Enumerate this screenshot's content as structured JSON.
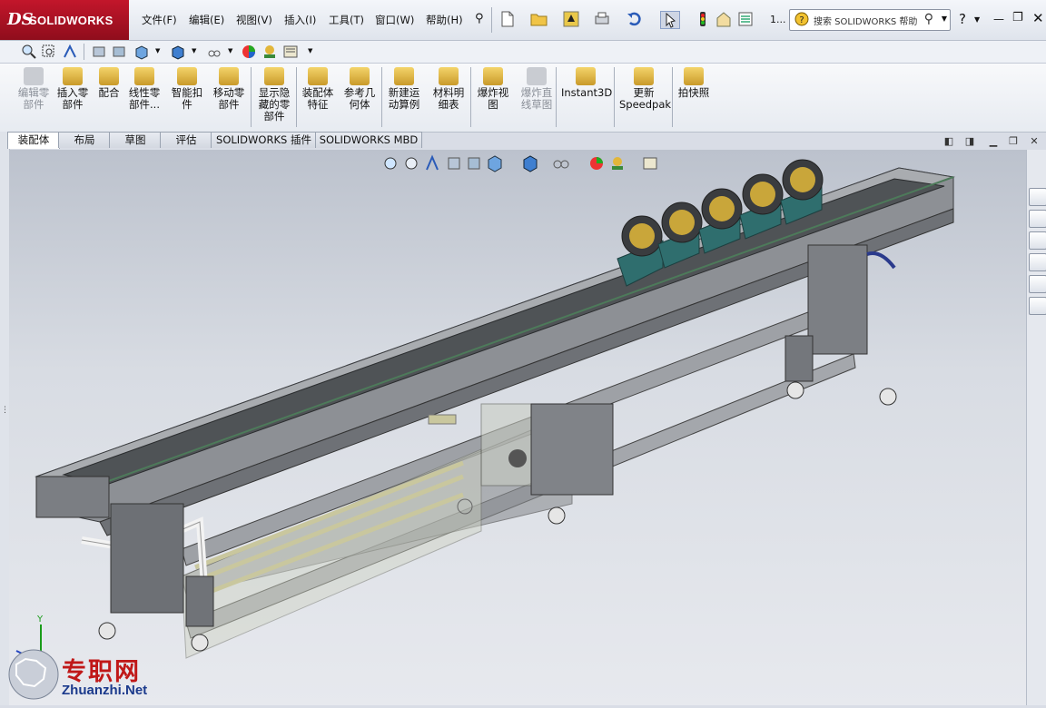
{
  "app": {
    "brand_ds": "DS",
    "brand_name": "SOLIDWORKS"
  },
  "menu": [
    "文件(F)",
    "编辑(E)",
    "视图(V)",
    "插入(I)",
    "工具(T)",
    "窗口(W)",
    "帮助(H)"
  ],
  "toolbar": {
    "counter": "1...",
    "search_placeholder": "搜索 SOLIDWORKS 帮助"
  },
  "command_manager": [
    {
      "label": "编辑零\n部件",
      "disabled": true,
      "icon": "edit-component-icon"
    },
    {
      "label": "插入零\n部件",
      "disabled": false,
      "icon": "insert-component-icon"
    },
    {
      "label": "配合",
      "disabled": false,
      "icon": "mate-icon"
    },
    {
      "label": "线性零\n部件...",
      "disabled": false,
      "icon": "linear-pattern-icon"
    },
    {
      "label": "智能扣\n件",
      "disabled": false,
      "icon": "smart-fastener-icon"
    },
    {
      "label": "移动零\n部件",
      "disabled": false,
      "icon": "move-component-icon"
    },
    {
      "label": "显示隐\n藏的零\n部件",
      "disabled": false,
      "icon": "show-hidden-icon"
    },
    {
      "label": "装配体\n特征",
      "disabled": false,
      "icon": "assembly-feature-icon"
    },
    {
      "label": "参考几\n何体",
      "disabled": false,
      "icon": "reference-geometry-icon"
    },
    {
      "label": "新建运\n动算例",
      "disabled": false,
      "icon": "motion-study-icon"
    },
    {
      "label": "材料明\n细表",
      "disabled": false,
      "icon": "bom-icon"
    },
    {
      "label": "爆炸视\n图",
      "disabled": false,
      "icon": "exploded-view-icon"
    },
    {
      "label": "爆炸直\n线草图",
      "disabled": true,
      "icon": "explode-line-icon"
    },
    {
      "label": "Instant3D",
      "disabled": false,
      "icon": "instant3d-icon"
    },
    {
      "label": "更新\nSpeedpak",
      "disabled": false,
      "icon": "speedpak-icon"
    },
    {
      "label": "拍快照",
      "disabled": false,
      "icon": "snapshot-icon"
    }
  ],
  "tabs": [
    {
      "label": "装配体",
      "active": true
    },
    {
      "label": "布局",
      "active": false
    },
    {
      "label": "草图",
      "active": false
    },
    {
      "label": "评估",
      "active": false
    },
    {
      "label": "SOLIDWORKS 插件",
      "active": false
    },
    {
      "label": "SOLIDWORKS MBD",
      "active": false
    }
  ],
  "watermark": {
    "cn": "专职网",
    "en": "Zhuanzhi.Net"
  },
  "colors": {
    "brand_red": "#b4121f",
    "model_steel": "#8c8f93",
    "roller_gold": "#c9a63a",
    "motor_teal": "#2f6e6e"
  }
}
